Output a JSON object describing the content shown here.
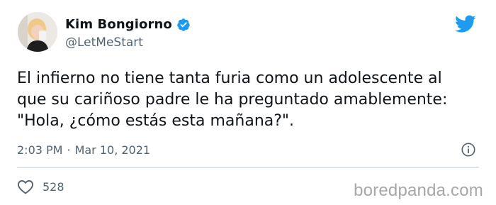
{
  "author": {
    "display_name": "Kim Bongiorno",
    "handle": "@LetMeStart",
    "verified": true
  },
  "tweet": {
    "text_lines": [
      "El infierno no tiene tanta furia como un adolescente al",
      "que su cariñoso padre le ha preguntado amablemente:",
      "\"Hola, ¿cómo estás esta mañana?\"."
    ],
    "time": "2:03 PM",
    "separator": "·",
    "date": "Mar 10, 2021"
  },
  "engagement": {
    "likes": "528"
  },
  "watermark": "boredpanda.com",
  "colors": {
    "twitter_blue": "#1d9bf0",
    "text_primary": "#0f1419",
    "text_secondary": "#536471",
    "divider": "#cfd9de"
  },
  "icons": {
    "verified": "verified-badge-icon",
    "brand": "twitter-bird-icon",
    "info": "info-icon",
    "like": "heart-icon"
  }
}
